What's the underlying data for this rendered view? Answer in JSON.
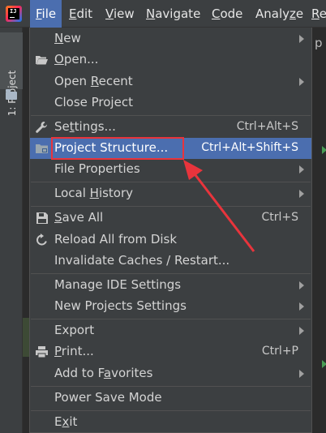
{
  "menubar": {
    "logo_text": "IJ",
    "items": [
      {
        "pre": "",
        "mn": "F",
        "post": "ile"
      },
      {
        "pre": "",
        "mn": "E",
        "post": "dit"
      },
      {
        "pre": "",
        "mn": "V",
        "post": "iew"
      },
      {
        "pre": "",
        "mn": "N",
        "post": "avigate"
      },
      {
        "pre": "",
        "mn": "C",
        "post": "ode"
      },
      {
        "pre": "Analy",
        "mn": "z",
        "post": "e"
      },
      {
        "pre": "",
        "mn": "R",
        "post": "e"
      }
    ]
  },
  "tool_window": {
    "project_tab_label": "1: Project"
  },
  "editor": {
    "fragment": "p"
  },
  "file_menu": {
    "items": [
      {
        "pre": "",
        "mn": "N",
        "post": "ew",
        "shortcut": ""
      },
      {
        "pre": "",
        "mn": "O",
        "post": "pen...",
        "shortcut": ""
      },
      {
        "pre": "Open ",
        "mn": "R",
        "post": "ecent",
        "shortcut": ""
      },
      {
        "pre": "Close Project",
        "mn": "",
        "post": "",
        "shortcut": ""
      },
      {
        "pre": "Se",
        "mn": "t",
        "post": "tings...",
        "shortcut": "Ctrl+Alt+S"
      },
      {
        "pre": "Project Structure...",
        "mn": "",
        "post": "",
        "shortcut": "Ctrl+Alt+Shift+S"
      },
      {
        "pre": "File Properties",
        "mn": "",
        "post": "",
        "shortcut": ""
      },
      {
        "pre": "Local ",
        "mn": "H",
        "post": "istory",
        "shortcut": ""
      },
      {
        "pre": "",
        "mn": "S",
        "post": "ave All",
        "shortcut": "Ctrl+S"
      },
      {
        "pre": "Reload All from Disk",
        "mn": "",
        "post": "",
        "shortcut": ""
      },
      {
        "pre": "Invalidate Caches / Restart...",
        "mn": "",
        "post": "",
        "shortcut": ""
      },
      {
        "pre": "Manage IDE Settings",
        "mn": "",
        "post": "",
        "shortcut": ""
      },
      {
        "pre": "New Projects Settings",
        "mn": "",
        "post": "",
        "shortcut": ""
      },
      {
        "pre": "Export",
        "mn": "",
        "post": "",
        "shortcut": ""
      },
      {
        "pre": "",
        "mn": "P",
        "post": "rint...",
        "shortcut": "Ctrl+P"
      },
      {
        "pre": "Add to F",
        "mn": "a",
        "post": "vorites",
        "shortcut": ""
      },
      {
        "pre": "Power Save Mode",
        "mn": "",
        "post": "",
        "shortcut": ""
      },
      {
        "pre": "E",
        "mn": "x",
        "post": "it",
        "shortcut": ""
      }
    ]
  },
  "icons": {
    "open": "folder-open-icon",
    "settings": "wrench-icon",
    "project_structure": "project-structure-folder-icon",
    "save_all": "floppy-disk-icon",
    "reload": "reload-icon",
    "print": "printer-icon"
  },
  "colors": {
    "menubar_bg": "#3c3f41",
    "menu_bg": "#3c3f41",
    "highlight": "#4b6eaf",
    "annotation_red": "#e8343c",
    "text": "#d4d4d4"
  }
}
